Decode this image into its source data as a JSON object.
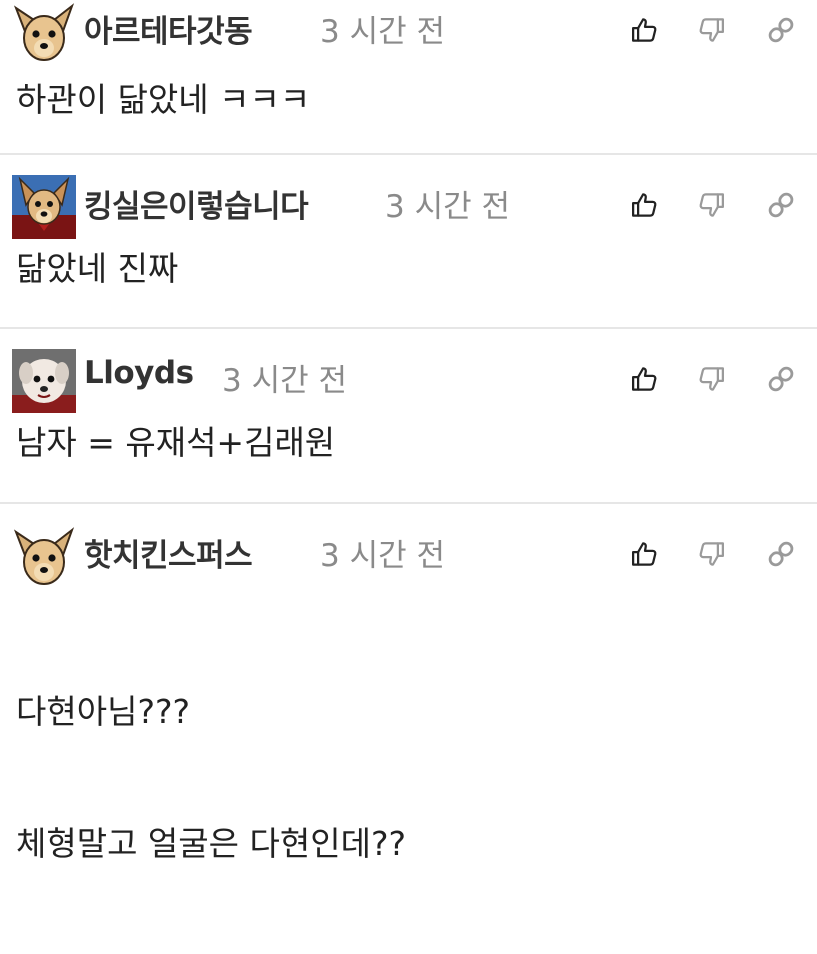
{
  "comments": [
    {
      "username": "아르테타갓동",
      "timestamp": "3 시간 전",
      "avatar": "chihuahua-avatar",
      "text": "하관이 닮았네 ㅋㅋㅋ"
    },
    {
      "username": "킹실은이렇습니다",
      "timestamp": "3 시간 전",
      "avatar": "dog-red-cape-avatar",
      "text": "닮았네 진짜"
    },
    {
      "username": "Lloyds",
      "timestamp": "3 시간 전",
      "avatar": "lloyds-dog-avatar",
      "text": "남자 = 유재석+김래원"
    },
    {
      "username": "핫치킨스퍼스",
      "timestamp": "3 시간 전",
      "avatar": "chihuahua-avatar",
      "text_lines": [
        "다현아님???",
        "체형말고 얼굴은 다현인데??"
      ]
    }
  ],
  "icons": {
    "like": "thumbs-up-icon",
    "dislike": "thumbs-down-icon",
    "link": "link-icon"
  },
  "colors": {
    "username": "#333333",
    "timestamp": "#8a8a8a",
    "like_icon": "#222222",
    "muted_icon": "#9a9a9a",
    "divider": "#e6e6e6"
  }
}
